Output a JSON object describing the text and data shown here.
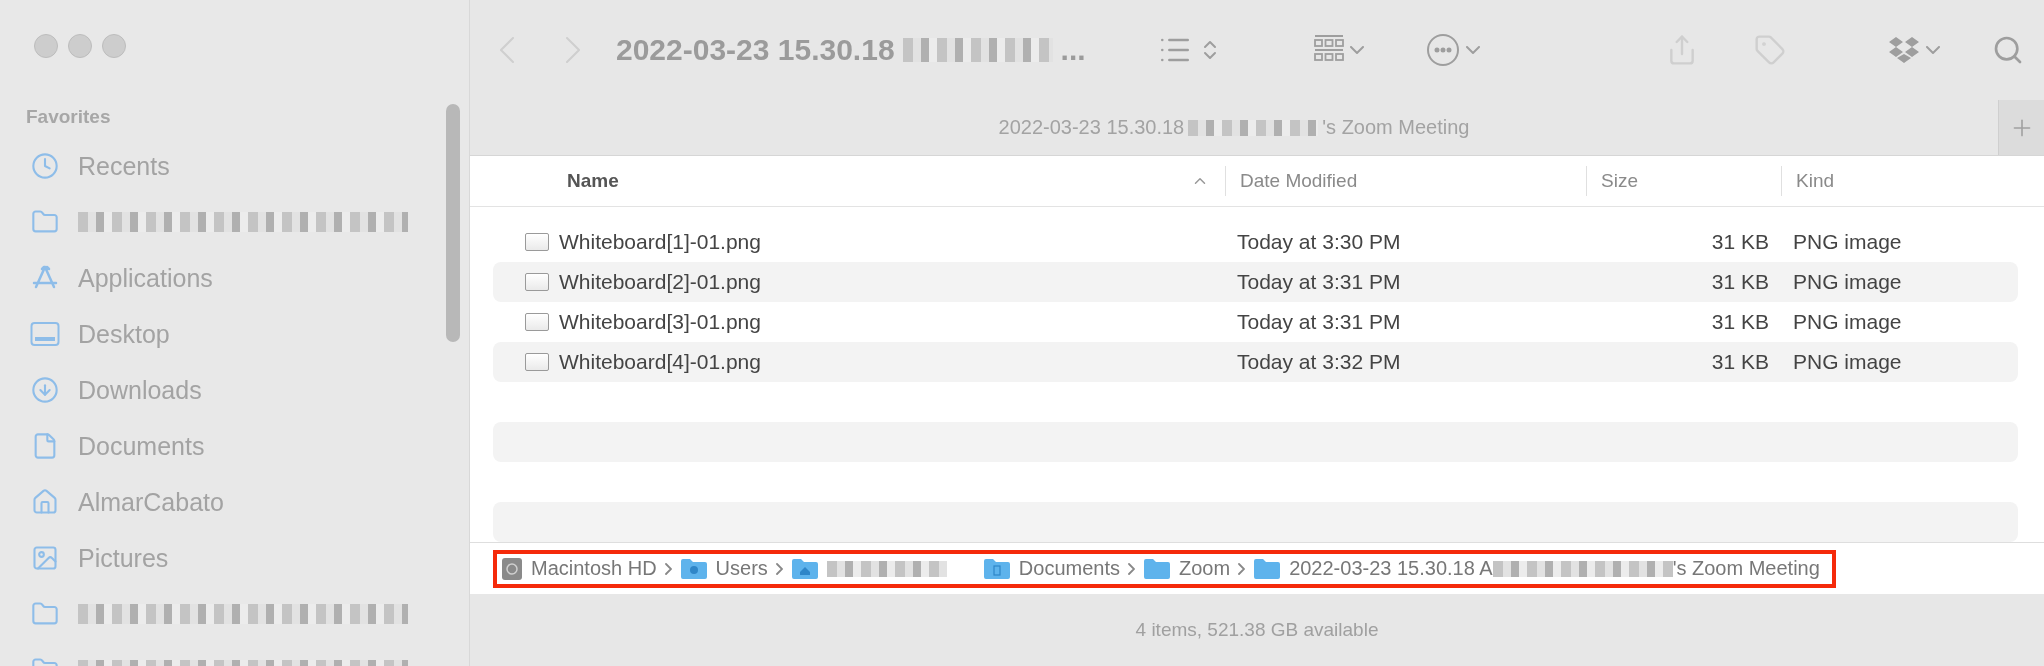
{
  "window": {
    "title": {
      "start": "2022-03-23 15.30.18",
      "redacted": true,
      "end": "..."
    }
  },
  "toolbar": {
    "back": {
      "disabled": true
    },
    "forward": {
      "disabled": true
    },
    "share": {
      "disabled": true
    },
    "tags": {
      "disabled": true
    }
  },
  "sidebar": {
    "heading": "Favorites",
    "items": [
      {
        "kind": "recents",
        "label": "Recents"
      },
      {
        "kind": "folder",
        "redacted": true
      },
      {
        "kind": "applications",
        "label": "Applications"
      },
      {
        "kind": "desktop",
        "label": "Desktop"
      },
      {
        "kind": "downloads",
        "label": "Downloads"
      },
      {
        "kind": "document",
        "label": "Documents"
      },
      {
        "kind": "home",
        "label": "AlmarCabato"
      },
      {
        "kind": "pictures",
        "label": "Pictures"
      },
      {
        "kind": "folder",
        "redacted": true
      },
      {
        "kind": "folder",
        "redacted": true
      }
    ]
  },
  "tab": {
    "start": "2022-03-23 15.30.18",
    "redacted": true,
    "end": "'s Zoom Meeting"
  },
  "table": {
    "columns": [
      {
        "label": "Name",
        "sorted": true
      },
      {
        "label": "Date Modified",
        "sorted": false
      },
      {
        "label": "Size",
        "sorted": false
      },
      {
        "label": "Kind",
        "sorted": false
      }
    ],
    "rows": [
      {
        "name": "Whiteboard[1]-01.png",
        "date": "Today at 3:30 PM",
        "size": "31 KB",
        "kind": "PNG image"
      },
      {
        "name": "Whiteboard[2]-01.png",
        "date": "Today at 3:31 PM",
        "size": "31 KB",
        "kind": "PNG image"
      },
      {
        "name": "Whiteboard[3]-01.png",
        "date": "Today at 3:31 PM",
        "size": "31 KB",
        "kind": "PNG image"
      },
      {
        "name": "Whiteboard[4]-01.png",
        "date": "Today at 3:32 PM",
        "size": "31 KB",
        "kind": "PNG image"
      }
    ]
  },
  "path_bar": {
    "highlighted": true,
    "items": [
      {
        "kind": "disk",
        "label": "Macintosh HD"
      },
      {
        "kind": "users",
        "label": "Users"
      },
      {
        "kind": "home",
        "redacted": true
      },
      {
        "kind": "documents",
        "label": "Documents"
      },
      {
        "kind": "folder",
        "label": "Zoom"
      },
      {
        "kind": "folder",
        "label": "2022-03-23 15.30.18 A",
        "redacted": true,
        "label_end": "'s Zoom Meeting"
      }
    ]
  },
  "status_bar": "4 items, 521.38 GB available"
}
